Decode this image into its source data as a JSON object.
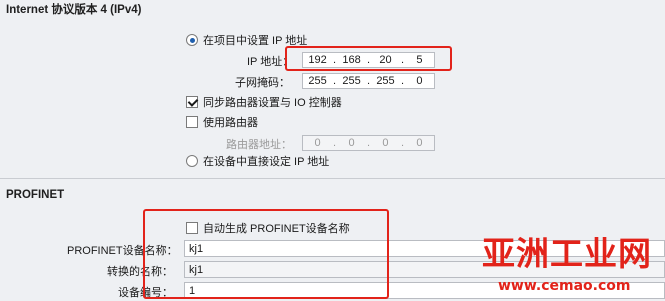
{
  "ipv4": {
    "title": "Internet 协议版本 4 (IPv4)",
    "radio_project": "在项目中设置 IP 地址",
    "ip_label": "IP 地址：",
    "ip": [
      "192",
      "168",
      "20",
      "5"
    ],
    "subnet_label": "子网掩码：",
    "subnet": [
      "255",
      "255",
      "255",
      "0"
    ],
    "sync_router": "同步路由器设置与 IO 控制器",
    "use_router": "使用路由器",
    "router_label": "路由器地址：",
    "router": [
      "0",
      "0",
      "0",
      "0"
    ],
    "radio_device": "在设备中直接设定 IP 地址"
  },
  "profinet": {
    "title": "PROFINET",
    "auto_name": "自动生成 PROFINET设备名称",
    "device_name_label": "PROFINET设备名称：",
    "device_name": "kj1",
    "converted_label": "转换的名称：",
    "converted": "kj1",
    "device_number_label": "设备编号：",
    "device_number": "1"
  },
  "watermark": {
    "title": "亚洲工业网",
    "url": "www.cemao.com"
  },
  "colors": {
    "highlight": "#e2231a",
    "radio_selected": "#1f5fae"
  }
}
